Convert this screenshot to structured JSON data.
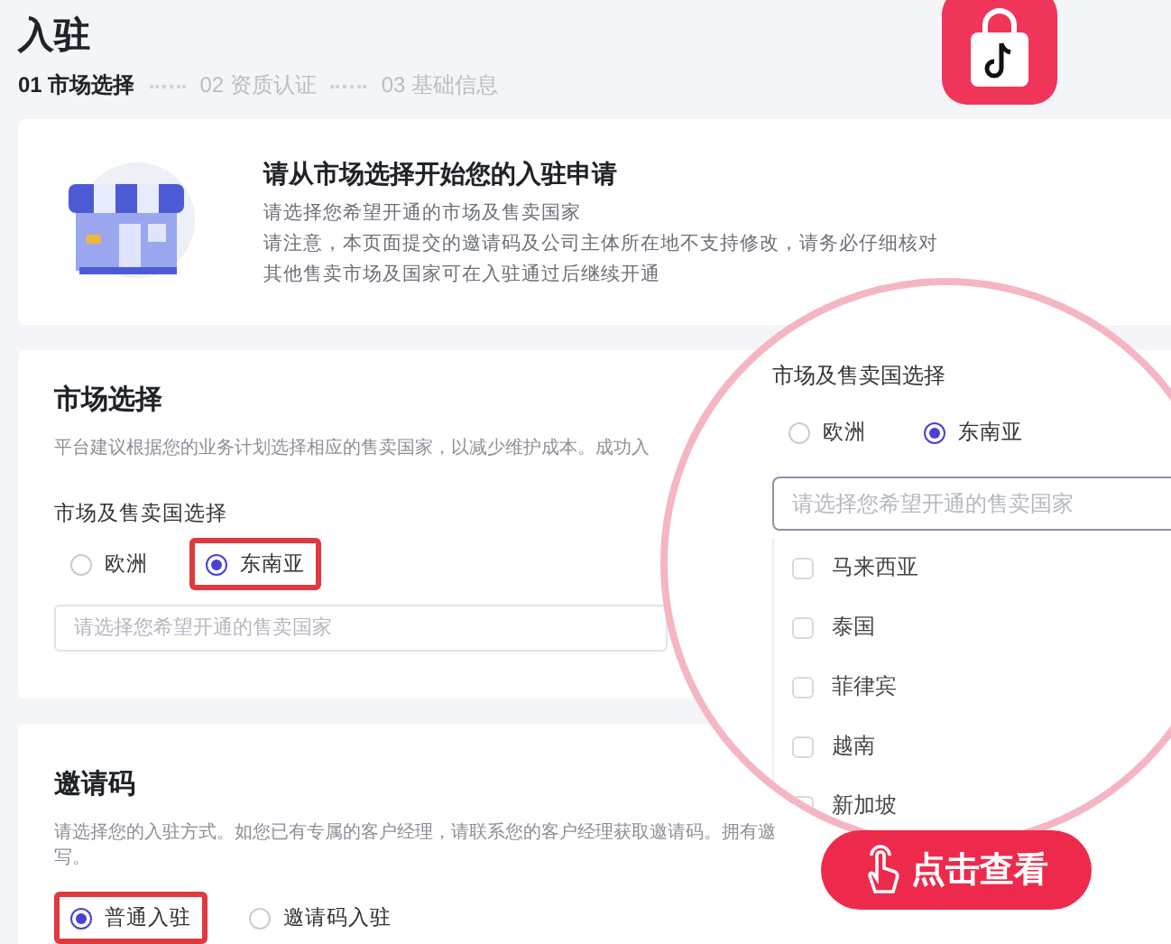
{
  "title": "入驻",
  "steps": [
    {
      "label": "01 市场选择",
      "selected": true
    },
    {
      "label": "02 资质认证",
      "selected": false
    },
    {
      "label": "03 基础信息",
      "selected": false
    }
  ],
  "notice": {
    "heading": "请从市场选择开始您的入驻申请",
    "lines": [
      "请选择您希望开通的市场及售卖国家",
      "请注意，本页面提交的邀请码及公司主体所在地不支持修改，请务必仔细核对",
      "其他售卖市场及国家可在入驻通过后继续开通"
    ]
  },
  "market": {
    "heading": "市场选择",
    "description": "平台建议根据您的业务计划选择相应的售卖国家，以减少维护成本。成功入",
    "field_label": "市场及售卖国选择",
    "options": [
      {
        "label": "欧洲",
        "selected": false,
        "highlighted": false
      },
      {
        "label": "东南亚",
        "selected": true,
        "highlighted": true
      }
    ],
    "country_field": {
      "placeholder": "请选择您希望开通的售卖国家"
    }
  },
  "invite": {
    "heading": "邀请码",
    "description_lines": [
      "请选择您的入驻方式。如您已有专属的客户经理，请联系您的客户经理获取邀请码。拥有邀",
      "写。"
    ],
    "options": [
      {
        "label": "普通入驻",
        "selected": true,
        "highlighted": true
      },
      {
        "label": "邀请码入驻",
        "selected": false,
        "highlighted": false
      }
    ]
  },
  "magnifier": {
    "field_label": "市场及售卖国选择",
    "options": [
      {
        "label": "欧洲",
        "selected": false
      },
      {
        "label": "东南亚",
        "selected": true
      }
    ],
    "country_field": {
      "placeholder": "请选择您希望开通的售卖国家"
    },
    "countries": [
      {
        "label": "马来西亚",
        "checked": false
      },
      {
        "label": "泰国",
        "checked": false
      },
      {
        "label": "菲律宾",
        "checked": false
      },
      {
        "label": "越南",
        "checked": false
      },
      {
        "label": "新加坡",
        "checked": false
      }
    ]
  },
  "overlay_button": {
    "label": "点击查看"
  }
}
